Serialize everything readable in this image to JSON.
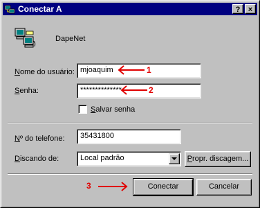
{
  "window": {
    "title": "Conectar A",
    "help_label": "?",
    "close_label": "×"
  },
  "connection": {
    "name": "DapeNet"
  },
  "form": {
    "username_label_u": "N",
    "username_label_rest": "ome do usuário:",
    "username_value": "mjoaquim",
    "password_label_u": "S",
    "password_label_rest": "enha:",
    "password_value": "**************",
    "save_password_label_u": "S",
    "save_password_label_rest": "alvar senha",
    "save_password_checked": false,
    "phone_label_u": "N",
    "phone_label_rest": "º do telefone:",
    "phone_value": "35431800",
    "dialing_label_u": "D",
    "dialing_label_rest": "iscando de:",
    "dialing_value": "Local padrão",
    "dial_props_label_u": "P",
    "dial_props_label_rest": "ropr. discagem..."
  },
  "buttons": {
    "connect": "Conectar",
    "cancel": "Cancelar"
  },
  "annotations": {
    "step1": "1",
    "step2": "2",
    "step3": "3",
    "color": "#e00000"
  }
}
